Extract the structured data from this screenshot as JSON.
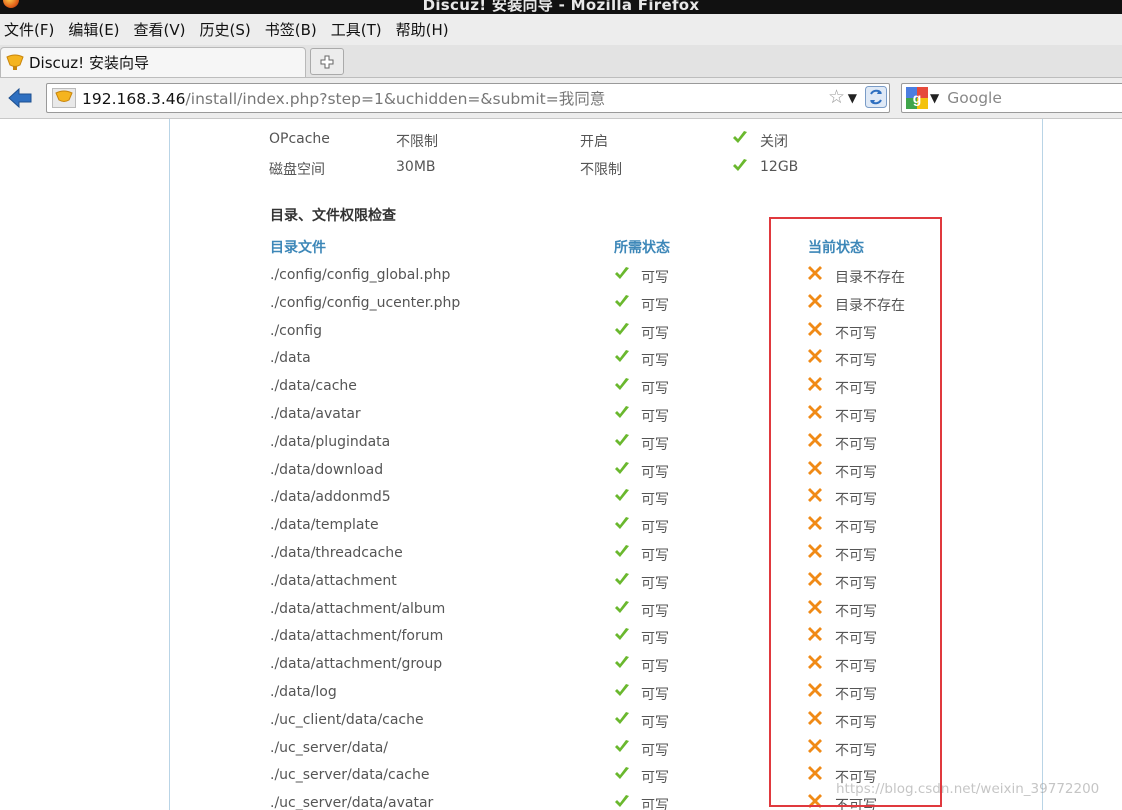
{
  "window": {
    "title": "Discuz! 安装向导 - Mozilla Firefox"
  },
  "menubar": {
    "items": [
      "文件(F)",
      "编辑(E)",
      "查看(V)",
      "历史(S)",
      "书签(B)",
      "工具(T)",
      "帮助(H)"
    ]
  },
  "tab": {
    "title": "Discuz! 安装向导"
  },
  "address": {
    "host": "192.168.3.46",
    "path": "/install/index.php?step=1&uchidden=&submit=我同意"
  },
  "search": {
    "placeholder": "Google"
  },
  "env_rows": [
    {
      "name": "OPcache",
      "required": "不限制",
      "best": "开启",
      "current": "关闭"
    },
    {
      "name": "磁盘空间",
      "required": "30MB",
      "best": "不限制",
      "current": "12GB"
    }
  ],
  "section_title": "目录、文件权限检查",
  "perm_headers": {
    "path": "目录文件",
    "required": "所需状态",
    "current": "当前状态"
  },
  "perm_rows": [
    {
      "path": "./config/config_global.php",
      "required": "可写",
      "current": "目录不存在"
    },
    {
      "path": "./config/config_ucenter.php",
      "required": "可写",
      "current": "目录不存在"
    },
    {
      "path": "./config",
      "required": "可写",
      "current": "不可写"
    },
    {
      "path": "./data",
      "required": "可写",
      "current": "不可写"
    },
    {
      "path": "./data/cache",
      "required": "可写",
      "current": "不可写"
    },
    {
      "path": "./data/avatar",
      "required": "可写",
      "current": "不可写"
    },
    {
      "path": "./data/plugindata",
      "required": "可写",
      "current": "不可写"
    },
    {
      "path": "./data/download",
      "required": "可写",
      "current": "不可写"
    },
    {
      "path": "./data/addonmd5",
      "required": "可写",
      "current": "不可写"
    },
    {
      "path": "./data/template",
      "required": "可写",
      "current": "不可写"
    },
    {
      "path": "./data/threadcache",
      "required": "可写",
      "current": "不可写"
    },
    {
      "path": "./data/attachment",
      "required": "可写",
      "current": "不可写"
    },
    {
      "path": "./data/attachment/album",
      "required": "可写",
      "current": "不可写"
    },
    {
      "path": "./data/attachment/forum",
      "required": "可写",
      "current": "不可写"
    },
    {
      "path": "./data/attachment/group",
      "required": "可写",
      "current": "不可写"
    },
    {
      "path": "./data/log",
      "required": "可写",
      "current": "不可写"
    },
    {
      "path": "./uc_client/data/cache",
      "required": "可写",
      "current": "不可写"
    },
    {
      "path": "./uc_server/data/",
      "required": "可写",
      "current": "不可写"
    },
    {
      "path": "./uc_server/data/cache",
      "required": "可写",
      "current": "不可写"
    },
    {
      "path": "./uc_server/data/avatar",
      "required": "可写",
      "current": "不可写"
    }
  ],
  "watermark": "https://blog.csdn.net/weixin_39772200",
  "colors": {
    "ok": "#6ab82e",
    "error": "#f08a16",
    "header": "#3d87b8",
    "highlight": "#e0393e"
  }
}
